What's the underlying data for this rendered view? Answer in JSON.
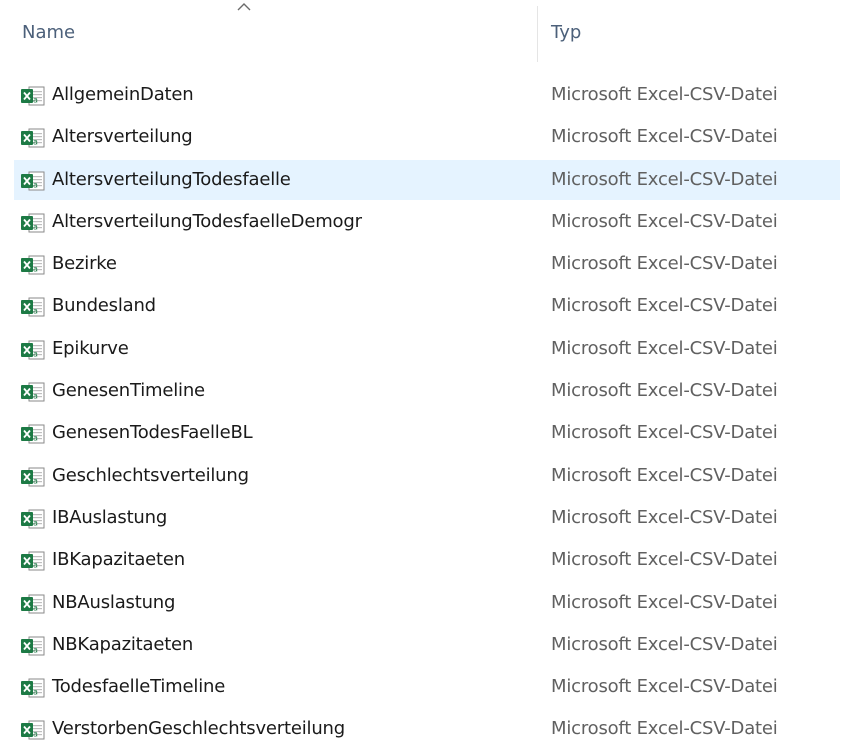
{
  "header": {
    "name_label": "Name",
    "type_label": "Typ",
    "sort_indicator": "chevron-up-icon"
  },
  "colors": {
    "selected_row_bg": "#e5f3ff",
    "excel_green": "#1d7a45"
  },
  "files": [
    {
      "name": "AllgemeinDaten",
      "type": "Microsoft Excel-CSV-Datei",
      "icon": "excel-csv-file-icon",
      "selected": false
    },
    {
      "name": "Altersverteilung",
      "type": "Microsoft Excel-CSV-Datei",
      "icon": "excel-csv-file-icon",
      "selected": false
    },
    {
      "name": "AltersverteilungTodesfaelle",
      "type": "Microsoft Excel-CSV-Datei",
      "icon": "excel-csv-file-icon",
      "selected": true
    },
    {
      "name": "AltersverteilungTodesfaelleDemogr",
      "type": "Microsoft Excel-CSV-Datei",
      "icon": "excel-csv-file-icon",
      "selected": false
    },
    {
      "name": "Bezirke",
      "type": "Microsoft Excel-CSV-Datei",
      "icon": "excel-csv-file-icon",
      "selected": false
    },
    {
      "name": "Bundesland",
      "type": "Microsoft Excel-CSV-Datei",
      "icon": "excel-csv-file-icon",
      "selected": false
    },
    {
      "name": "Epikurve",
      "type": "Microsoft Excel-CSV-Datei",
      "icon": "excel-csv-file-icon",
      "selected": false
    },
    {
      "name": "GenesenTimeline",
      "type": "Microsoft Excel-CSV-Datei",
      "icon": "excel-csv-file-icon",
      "selected": false
    },
    {
      "name": "GenesenTodesFaelleBL",
      "type": "Microsoft Excel-CSV-Datei",
      "icon": "excel-csv-file-icon",
      "selected": false
    },
    {
      "name": "Geschlechtsverteilung",
      "type": "Microsoft Excel-CSV-Datei",
      "icon": "excel-csv-file-icon",
      "selected": false
    },
    {
      "name": "IBAuslastung",
      "type": "Microsoft Excel-CSV-Datei",
      "icon": "excel-csv-file-icon",
      "selected": false
    },
    {
      "name": "IBKapazitaeten",
      "type": "Microsoft Excel-CSV-Datei",
      "icon": "excel-csv-file-icon",
      "selected": false
    },
    {
      "name": "NBAuslastung",
      "type": "Microsoft Excel-CSV-Datei",
      "icon": "excel-csv-file-icon",
      "selected": false
    },
    {
      "name": "NBKapazitaeten",
      "type": "Microsoft Excel-CSV-Datei",
      "icon": "excel-csv-file-icon",
      "selected": false
    },
    {
      "name": "TodesfaelleTimeline",
      "type": "Microsoft Excel-CSV-Datei",
      "icon": "excel-csv-file-icon",
      "selected": false
    },
    {
      "name": "VerstorbenGeschlechtsverteilung",
      "type": "Microsoft Excel-CSV-Datei",
      "icon": "excel-csv-file-icon",
      "selected": false
    }
  ]
}
